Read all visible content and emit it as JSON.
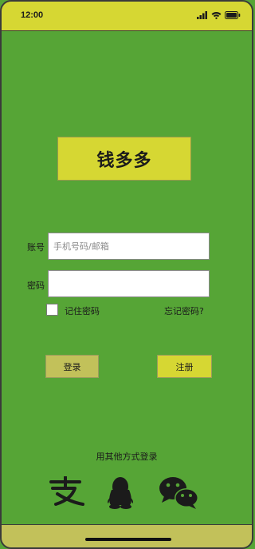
{
  "status_bar": {
    "time": "12:00",
    "icons": [
      "signal-icon",
      "wifi-icon",
      "battery-icon"
    ]
  },
  "logo": {
    "text": "钱多多"
  },
  "login_form": {
    "account_label": "账号",
    "account_placeholder": "手机号码/邮箱",
    "account_value": "",
    "password_label": "密码",
    "password_value": "",
    "remember_label": "记住密码",
    "remember_checked": false,
    "forgot_label": "忘记密码?"
  },
  "actions": {
    "login_label": "登录",
    "register_label": "注册"
  },
  "other_login": {
    "label": "用其他方式登录",
    "methods": [
      "alipay-icon",
      "qq-icon",
      "wechat-icon"
    ]
  },
  "colors": {
    "background": "#56a536",
    "status_bar": "#d6d733",
    "logo_box": "#d6d733",
    "login_button": "#c2c15a",
    "register_button": "#d6d733",
    "bottom_bar": "#c2c15a"
  }
}
